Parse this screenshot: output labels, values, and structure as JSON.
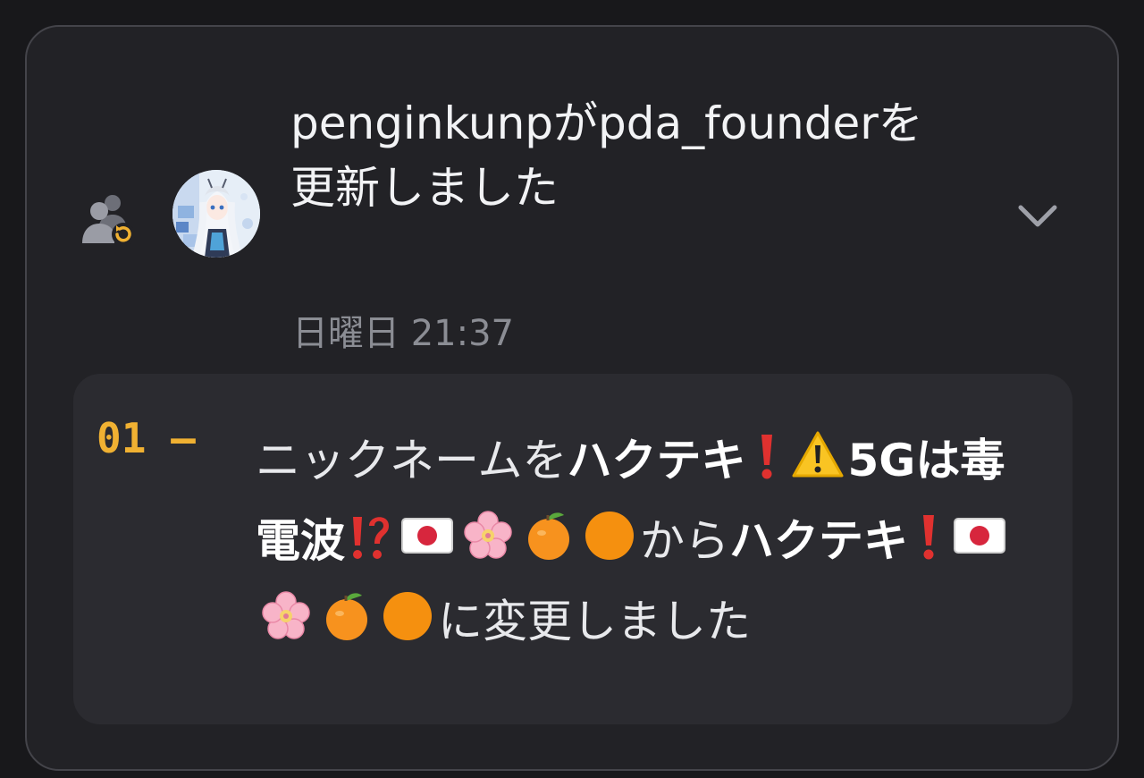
{
  "notification": {
    "title": "penginkunpがpda_founderを更新しました",
    "timestamp": "日曜日 21:37",
    "icon": "role-update-icon",
    "expand_icon": "chevron-down-icon",
    "colors": {
      "background": "#222226",
      "accent": "#f0b132",
      "text": "#f2f3f5",
      "muted": "#8b8d94"
    }
  },
  "change": {
    "index": "01 –",
    "segments": {
      "before_prefix": "ニックネームを",
      "old_name_part1": "ハクテキ",
      "old_name_part2": "5G",
      "old_name_part3": "は毒電波",
      "from_label": "から",
      "new_name": "ハクテキ",
      "suffix": "に変更しました"
    },
    "old_nickname": "ハクテキ❗️⚠️5Gは毒電波⁉️🇯🇵🌸🍊🟠",
    "new_nickname": "ハクテキ❗️🇯🇵🌸🍊🟠"
  }
}
